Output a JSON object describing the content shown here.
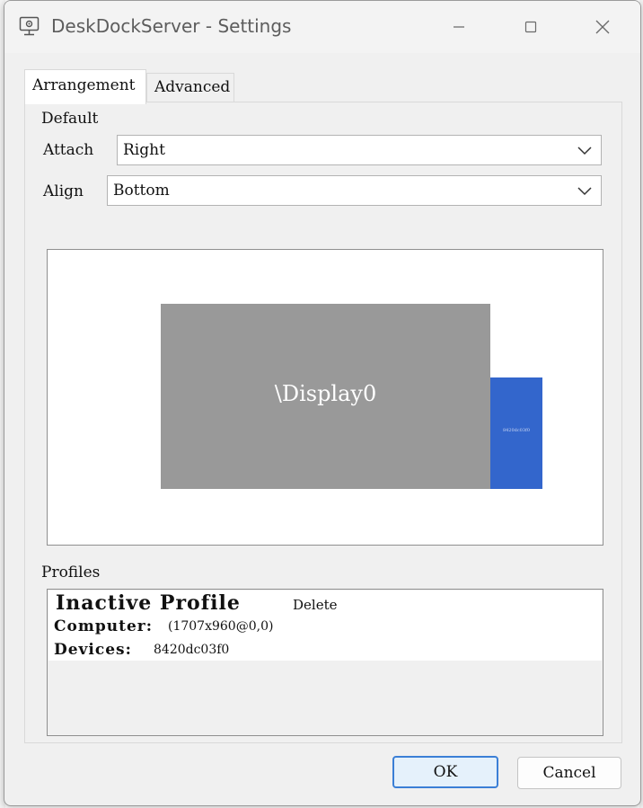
{
  "window": {
    "title": "DeskDockServer - Settings",
    "app_icon": "monitor-gear-icon",
    "controls": [
      "minimize-icon",
      "maximize-icon",
      "close-icon"
    ]
  },
  "tabs": [
    {
      "label": "Arrangement",
      "selected": true
    },
    {
      "label": "Advanced",
      "selected": false
    }
  ],
  "default_group": {
    "title": "Default",
    "attach_label": "Attach",
    "attach_value": "Right",
    "align_label": "Align",
    "align_value": "Bottom"
  },
  "preview": {
    "display_label": "\\Display0",
    "device_label": "8420dc03f0",
    "display_color": "#999999",
    "device_color": "#3366cc"
  },
  "profiles": {
    "title": "Profiles",
    "items": [
      {
        "name": "Inactive Profile",
        "delete_label": "Delete",
        "computer_label": "Computer:",
        "computer_value": "(1707x960@0,0)",
        "devices_label": "Devices:",
        "devices_value": "8420dc03f0"
      }
    ]
  },
  "buttons": {
    "ok": "OK",
    "cancel": "Cancel"
  }
}
